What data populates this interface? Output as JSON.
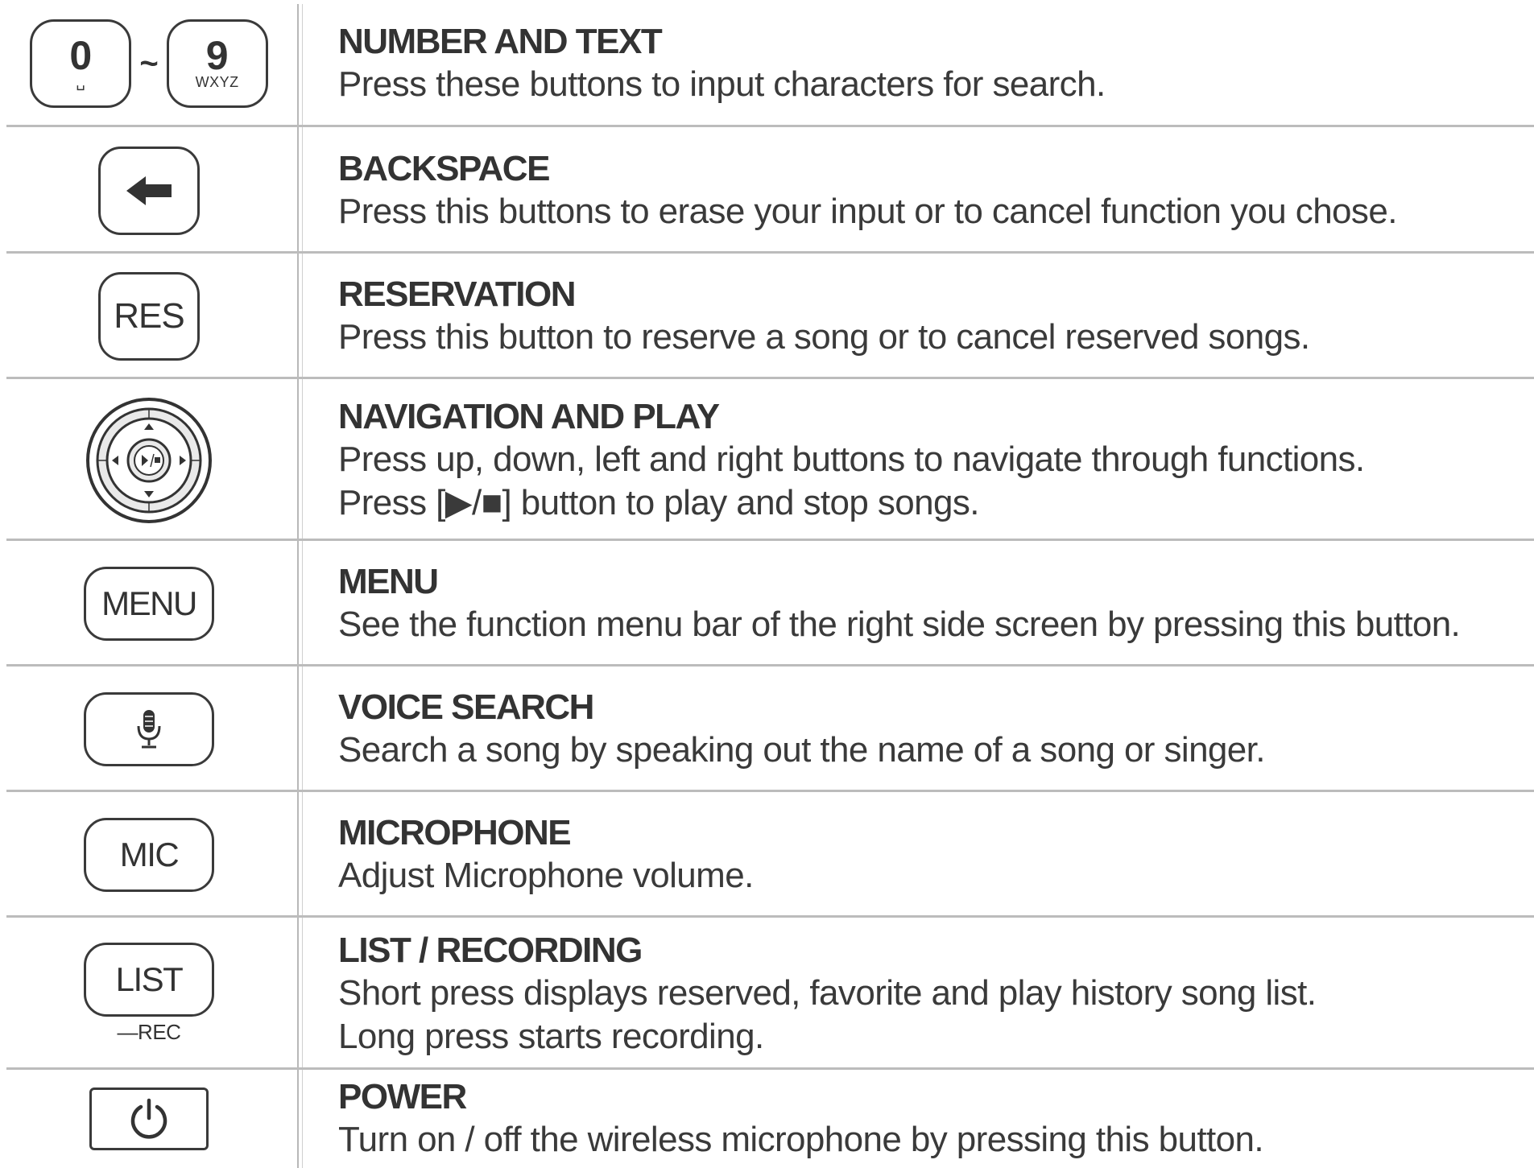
{
  "rows": [
    {
      "title": "NUMBER AND TEXT",
      "desc": [
        "Press these buttons to input characters for search."
      ],
      "icon": "number-keys",
      "key_left_digit": "0",
      "key_left_sub": "␣",
      "key_tilde": "~",
      "key_right_digit": "9",
      "key_right_sub": "WXYZ"
    },
    {
      "title": "BACKSPACE",
      "desc": [
        "Press this buttons to erase your input or to cancel function you chose."
      ],
      "icon": "backspace-arrow-icon"
    },
    {
      "title": "RESERVATION",
      "desc": [
        "Press this button to reserve a song or to cancel reserved songs."
      ],
      "icon": "res",
      "label": "RES"
    },
    {
      "title": "NAVIGATION AND PLAY",
      "desc": [
        "Press up, down, left and right buttons to navigate through functions.",
        "Press [▶/■] button to play and stop songs."
      ],
      "icon": "navigation-dial-icon"
    },
    {
      "title": "MENU",
      "desc": [
        "See the function menu bar of the right side screen by pressing this button."
      ],
      "icon": "menu",
      "label": "MENU"
    },
    {
      "title": "VOICE SEARCH",
      "desc": [
        "Search a song by speaking out the name of a song or singer."
      ],
      "icon": "microphone-icon"
    },
    {
      "title": "MICROPHONE",
      "desc": [
        "Adjust Microphone volume."
      ],
      "icon": "mic",
      "label": "MIC"
    },
    {
      "title": "LIST / RECORDING",
      "desc": [
        "Short press displays reserved, favorite and play history song list.",
        "Long press starts recording."
      ],
      "icon": "list",
      "label": "LIST",
      "sub_label": "—REC"
    },
    {
      "title": "POWER",
      "desc": [
        "Turn on / off the wireless microphone by pressing this button."
      ],
      "icon": "power-icon"
    }
  ],
  "colors": {
    "text": "#3a3a3a",
    "title": "#333333",
    "border": "#3a3a3a",
    "rule": "#bcbcbc"
  }
}
